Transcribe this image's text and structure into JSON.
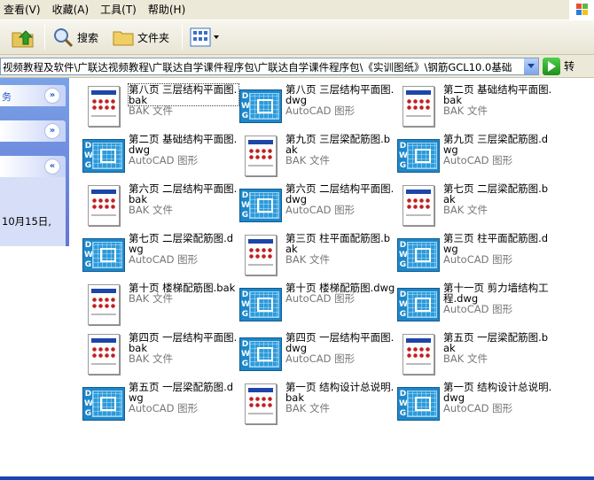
{
  "menu": {
    "items": [
      "查看(V)",
      "收藏(A)",
      "工具(T)",
      "帮助(H)"
    ]
  },
  "toolbar": {
    "search_label": "搜索",
    "folders_label": "文件夹"
  },
  "address": {
    "path": "视频教程及软件\\广联达视频教程\\广联达自学课件程序包\\广联达自学课件程序包\\《实训图纸》\\钢筋GCL10.0基础",
    "go_label": "转"
  },
  "taskpane": {
    "panel1_label": "务",
    "date_fragment": "10月15日,"
  },
  "files": [
    {
      "name": "第八页 三层结构平面图.bak",
      "type": "BAK 文件",
      "icon": "bak-file-icon",
      "selected": true
    },
    {
      "name": "第八页 三层结构平面图.dwg",
      "type": "AutoCAD 图形",
      "icon": "dwg-file-icon"
    },
    {
      "name": "第二页 基础结构平面图.bak",
      "type": "BAK 文件",
      "icon": "bak-file-icon"
    },
    {
      "name": "第二页 基础结构平面图.dwg",
      "type": "AutoCAD 图形",
      "icon": "dwg-file-icon"
    },
    {
      "name": "第九页 三层梁配筋图.bak",
      "type": "BAK 文件",
      "icon": "bak-file-icon"
    },
    {
      "name": "第九页 三层梁配筋图.dwg",
      "type": "AutoCAD 图形",
      "icon": "dwg-file-icon"
    },
    {
      "name": "第六页 二层结构平面图.bak",
      "type": "BAK 文件",
      "icon": "bak-file-icon"
    },
    {
      "name": "第六页 二层结构平面图.dwg",
      "type": "AutoCAD 图形",
      "icon": "dwg-file-icon"
    },
    {
      "name": "第七页 二层梁配筋图.bak",
      "type": "BAK 文件",
      "icon": "bak-file-icon"
    },
    {
      "name": "第七页 二层梁配筋图.dwg",
      "type": "AutoCAD 图形",
      "icon": "dwg-file-icon"
    },
    {
      "name": "第三页 柱平面配筋图.bak",
      "type": "BAK 文件",
      "icon": "bak-file-icon"
    },
    {
      "name": "第三页 柱平面配筋图.dwg",
      "type": "AutoCAD 图形",
      "icon": "dwg-file-icon"
    },
    {
      "name": "第十页 楼梯配筋图.bak",
      "type": "BAK 文件",
      "icon": "bak-file-icon"
    },
    {
      "name": "第十页 楼梯配筋图.dwg",
      "type": "AutoCAD 图形",
      "icon": "dwg-file-icon"
    },
    {
      "name": "第十一页 剪力墙结构工程.dwg",
      "type": "AutoCAD 图形",
      "icon": "dwg-file-icon"
    },
    {
      "name": "第四页 一层结构平面图.bak",
      "type": "BAK 文件",
      "icon": "bak-file-icon"
    },
    {
      "name": "第四页 一层结构平面图.dwg",
      "type": "AutoCAD 图形",
      "icon": "dwg-file-icon"
    },
    {
      "name": "第五页 一层梁配筋图.bak",
      "type": "BAK 文件",
      "icon": "bak-file-icon"
    },
    {
      "name": "第五页 一层梁配筋图.dwg",
      "type": "AutoCAD 图形",
      "icon": "dwg-file-icon"
    },
    {
      "name": "第一页 结构设计总说明.bak",
      "type": "BAK 文件",
      "icon": "bak-file-icon"
    },
    {
      "name": "第一页 结构设计总说明.dwg",
      "type": "AutoCAD 图形",
      "icon": "dwg-file-icon"
    }
  ],
  "colors": {
    "taskpane_blue": "#6375d6",
    "dwg_blue": "#1d87c9",
    "bak_red": "#c02020"
  }
}
